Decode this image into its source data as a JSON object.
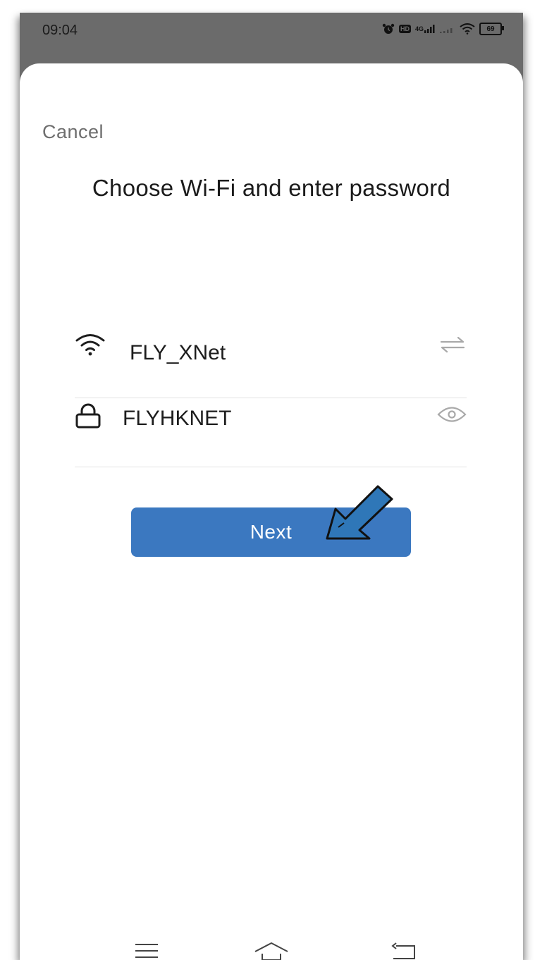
{
  "status_bar": {
    "time": "09:04",
    "icons": [
      "alarm-icon",
      "hd-icon",
      "signal-4g-icon",
      "signal-icon",
      "wifi-icon",
      "battery-icon"
    ],
    "hd_label": "HD",
    "network_label": "4G",
    "battery_level": "69"
  },
  "sheet": {
    "cancel_label": "Cancel",
    "title": "Choose Wi-Fi and enter password"
  },
  "wifi_row": {
    "icon": "wifi-icon",
    "ssid": "FLY_XNet",
    "switch_icon": "switch-network-icon"
  },
  "password_row": {
    "icon": "lock-icon",
    "password": "FLYHKNET",
    "visibility_icon": "eye-icon"
  },
  "next_button": {
    "label": "Next"
  },
  "annotation": {
    "type": "pointer-arrow",
    "color": "#2f77b8"
  },
  "nav_bar": {
    "items": [
      "menu-icon",
      "home-icon",
      "back-icon"
    ]
  },
  "colors": {
    "accent": "#3b78c0",
    "status_bar_bg": "#6b6b6b",
    "text_primary": "#1b1b1b",
    "text_secondary": "#6e6e6e",
    "divider": "#e2e2e2"
  }
}
